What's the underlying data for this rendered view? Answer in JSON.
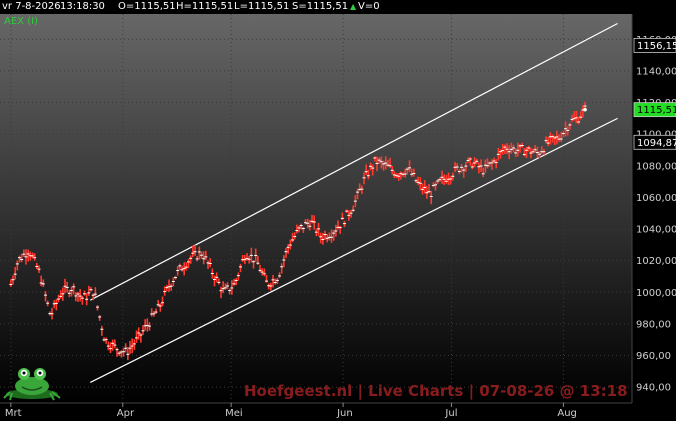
{
  "header": {
    "date": "vr 7-8-2026",
    "time": "13:18:30",
    "open": "O=1115,51",
    "high": "H=1115,51",
    "low": "L=1115,51",
    "settle": "S=1115,51",
    "volume": "V=0"
  },
  "watermark": "Hoefgeest.nl | Live Charts | 07-08-26 @ 13:18",
  "colors": {
    "background_top": "#676767",
    "background_bottom": "#000000",
    "price_bar": "#ff3b30",
    "price_cap": "#ffffff",
    "trend_line": "#ffffff",
    "current_price_bg": "#22dd22",
    "axis_text": "#cfcfcf",
    "series_label": "#2ecc40"
  },
  "chart_data": {
    "type": "line",
    "series": [
      {
        "name": "AEX (I)",
        "x": [
          "2026-03-01",
          "2026-03-03",
          "2026-03-06",
          "2026-03-09",
          "2026-03-12",
          "2026-03-15",
          "2026-03-18",
          "2026-03-21",
          "2026-03-24",
          "2026-03-27",
          "2026-03-30",
          "2026-04-02",
          "2026-04-05",
          "2026-04-08",
          "2026-04-11",
          "2026-04-14",
          "2026-04-17",
          "2026-04-20",
          "2026-04-23",
          "2026-04-26",
          "2026-04-29",
          "2026-05-02",
          "2026-05-05",
          "2026-05-08",
          "2026-05-11",
          "2026-05-14",
          "2026-05-17",
          "2026-05-20",
          "2026-05-23",
          "2026-05-26",
          "2026-05-29",
          "2026-06-01",
          "2026-06-04",
          "2026-06-07",
          "2026-06-10",
          "2026-06-13",
          "2026-06-16",
          "2026-06-19",
          "2026-06-22",
          "2026-06-25",
          "2026-06-28",
          "2026-07-01",
          "2026-07-04",
          "2026-07-07",
          "2026-07-10",
          "2026-07-13",
          "2026-07-16",
          "2026-07-19",
          "2026-07-22",
          "2026-07-25",
          "2026-07-28",
          "2026-07-31",
          "2026-08-03",
          "2026-08-05",
          "2026-08-07"
        ],
        "y": [
          1005,
          1020,
          1027,
          1012,
          985,
          1000,
          1003,
          996,
          1001,
          970,
          965,
          962,
          970,
          980,
          990,
          1005,
          1015,
          1022,
          1025,
          1012,
          1000,
          1005,
          1025,
          1020,
          1005,
          1010,
          1030,
          1040,
          1045,
          1035,
          1038,
          1045,
          1055,
          1072,
          1083,
          1080,
          1075,
          1078,
          1068,
          1062,
          1070,
          1075,
          1080,
          1082,
          1077,
          1083,
          1092,
          1090,
          1090,
          1088,
          1095,
          1098,
          1108,
          1110,
          1115.51
        ]
      }
    ],
    "trend_channel": [
      {
        "name": "upper",
        "x": [
          "2026-03-23",
          "2026-08-16"
        ],
        "y": [
          995,
          1170
        ]
      },
      {
        "name": "lower",
        "x": [
          "2026-03-23",
          "2026-08-16"
        ],
        "y": [
          943,
          1110
        ]
      }
    ],
    "price_labels": {
      "upper": "1156,15",
      "current": "1115,51",
      "lower": "1094,87",
      "upper_value": 1156.15,
      "current_value": 1115.51,
      "lower_value": 1094.87
    },
    "x_ticks": [
      {
        "label": "Mrt",
        "date": "2026-03-01"
      },
      {
        "label": "Apr",
        "date": "2026-04-01"
      },
      {
        "label": "Mei",
        "date": "2026-05-01"
      },
      {
        "label": "Jun",
        "date": "2026-06-01"
      },
      {
        "label": "Jul",
        "date": "2026-07-01"
      },
      {
        "label": "Aug",
        "date": "2026-08-01"
      }
    ],
    "y_ticks": [
      {
        "label": "940,00",
        "value": 940
      },
      {
        "label": "960,00",
        "value": 960
      },
      {
        "label": "980,00",
        "value": 980
      },
      {
        "label": "1000,00",
        "value": 1000
      },
      {
        "label": "1020,00",
        "value": 1020
      },
      {
        "label": "1040,00",
        "value": 1040
      },
      {
        "label": "1060,00",
        "value": 1060
      },
      {
        "label": "1080,00",
        "value": 1080
      },
      {
        "label": "1100,00",
        "value": 1100
      },
      {
        "label": "1120,00",
        "value": 1120
      },
      {
        "label": "1140,00",
        "value": 1140
      },
      {
        "label": "1160,00",
        "value": 1160
      }
    ],
    "xlim": [
      "2026-02-26",
      "2026-08-20"
    ],
    "ylim": [
      930,
      1176
    ],
    "grid": true,
    "y_axis_side": "right"
  }
}
